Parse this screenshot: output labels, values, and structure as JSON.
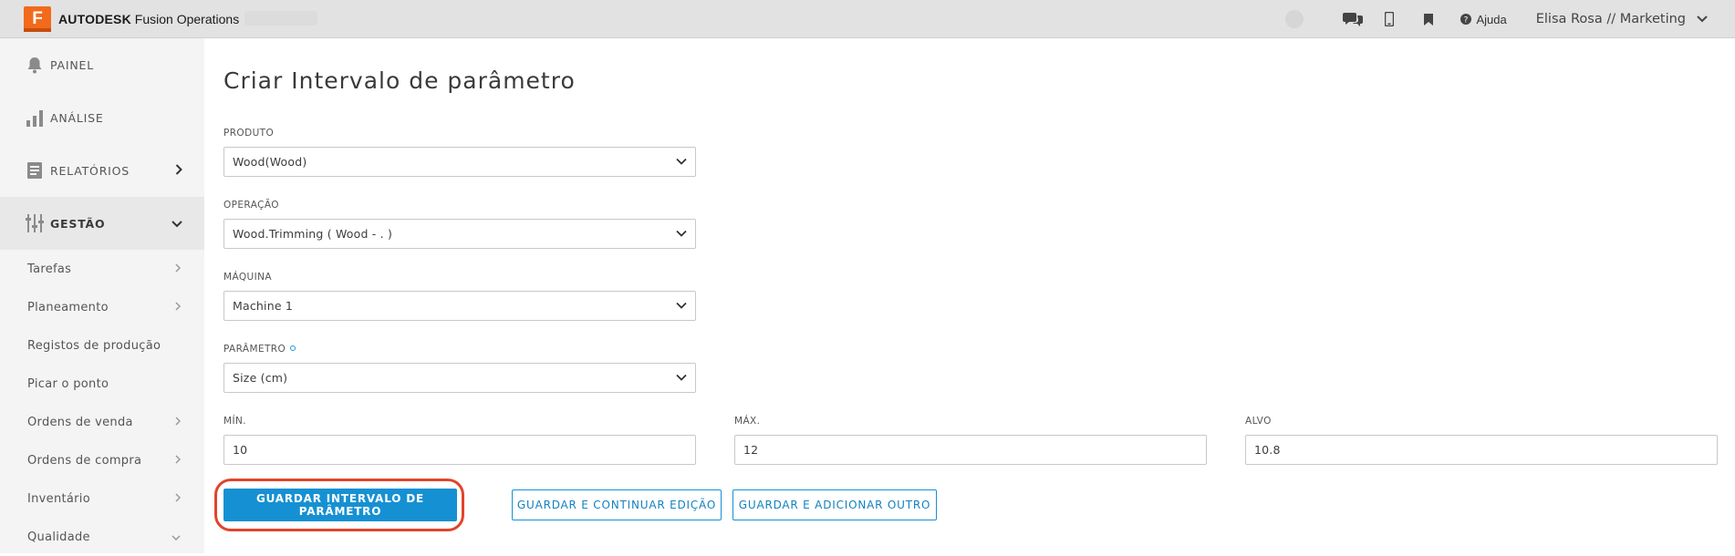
{
  "brand": {
    "logo_letter": "F",
    "name_bold": "AUTODESK",
    "name_rest": " Fusion Operations"
  },
  "topbar": {
    "icons": [
      "chat-icon",
      "mobile-icon",
      "bookmark-icon",
      "help-circle-icon"
    ],
    "help_label": "Ajuda",
    "user_label": "Elisa Rosa // Marketing"
  },
  "sidebar": {
    "main_items": [
      {
        "label": "PAINEL",
        "icon": "bell-icon"
      },
      {
        "label": "ANÁLISE",
        "icon": "bar-chart-icon"
      },
      {
        "label": "RELATÓRIOS",
        "icon": "report-icon"
      },
      {
        "label": "GESTÃO",
        "icon": "sliders-icon"
      }
    ],
    "sub_items": [
      {
        "label": "Tarefas"
      },
      {
        "label": "Planeamento"
      },
      {
        "label": "Registos de produção"
      },
      {
        "label": "Picar o ponto"
      },
      {
        "label": "Ordens de venda"
      },
      {
        "label": "Ordens de compra"
      },
      {
        "label": "Inventário"
      },
      {
        "label": "Qualidade"
      }
    ]
  },
  "form": {
    "title": "Criar Intervalo de parâmetro",
    "produto": {
      "label": "PRODUTO",
      "value": "Wood(Wood)"
    },
    "operacao": {
      "label": "OPERAÇÃO",
      "value": "Wood.Trimming ( Wood - . )"
    },
    "maquina": {
      "label": "MÁQUINA",
      "value": "Machine 1"
    },
    "parametro": {
      "label": "PARÂMETRO",
      "value": "Size (cm)"
    },
    "min": {
      "label": "MÍN.",
      "value": "10"
    },
    "max": {
      "label": "MÁX.",
      "value": "12"
    },
    "alvo": {
      "label": "ALVO",
      "value": "10.8"
    },
    "buttons": {
      "save": "GUARDAR INTERVALO DE PARÂMETRO",
      "save_continue": "GUARDAR E CONTINUAR EDIÇÃO",
      "save_add": "GUARDAR E ADICIONAR OUTRO"
    }
  },
  "colors": {
    "primary": "#1591d3",
    "highlight": "#e0442a",
    "brand_orange": "#f26a1b"
  }
}
